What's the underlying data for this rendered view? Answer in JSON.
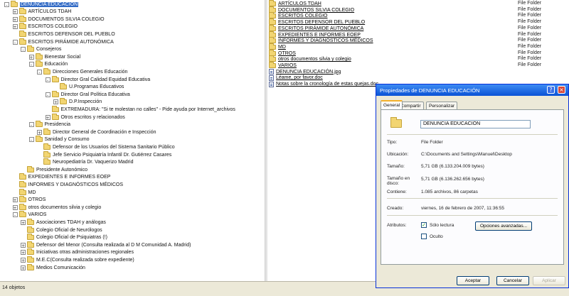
{
  "tree": [
    {
      "label": "DENUNCIA EDUCACIÓN",
      "level": 0,
      "exp": "-",
      "selected": true
    },
    {
      "label": "ARTÍCULOS TDAH",
      "level": 1,
      "exp": "+"
    },
    {
      "label": "DOCUMENTOS SILVIA COLEGIO",
      "level": 1,
      "exp": "+"
    },
    {
      "label": "ESCRITOS COLEGIO",
      "level": 1,
      "exp": "+"
    },
    {
      "label": "ESCRITOS DEFENSOR DEL PUEBLO",
      "level": 1,
      "exp": ""
    },
    {
      "label": "ESCRITOS PIRÁMIDE AUTONÓMICA",
      "level": 1,
      "exp": "-"
    },
    {
      "label": "Consejeros",
      "level": 2,
      "exp": "-"
    },
    {
      "label": "Bienestar Social",
      "level": 3,
      "exp": "+"
    },
    {
      "label": "Educación",
      "level": 3,
      "exp": "-"
    },
    {
      "label": "Direcciones Generales Educación",
      "level": 4,
      "exp": "-"
    },
    {
      "label": "Director Gral Calidad Equidad Educativa",
      "level": 5,
      "exp": "-"
    },
    {
      "label": "U.Programas Educativos",
      "level": 6,
      "exp": ""
    },
    {
      "label": "Director Gral Política Educativa",
      "level": 5,
      "exp": "-"
    },
    {
      "label": "D.P.Inspección",
      "level": 6,
      "exp": "+"
    },
    {
      "label": "EXTREMADURA: \"Si te molestan no calles\" - Pide ayuda por Internet_archivos",
      "level": 5,
      "exp": ""
    },
    {
      "label": "Otros escritos y relacionados",
      "level": 5,
      "exp": "+"
    },
    {
      "label": "Presidencia",
      "level": 3,
      "exp": "-"
    },
    {
      "label": "Director General de Coordinación e Inspección",
      "level": 4,
      "exp": "+"
    },
    {
      "label": "Sanidad y Consumo",
      "level": 3,
      "exp": "-"
    },
    {
      "label": "Defensor de los Usuarios del Sistema Sanitario Público",
      "level": 4,
      "exp": ""
    },
    {
      "label": "Jefe Servicio Psiquiatría Infantil Dr. Gutiérrez Casares",
      "level": 4,
      "exp": ""
    },
    {
      "label": "Neuropediatría Dr. Vaquerizo Madrid",
      "level": 4,
      "exp": ""
    },
    {
      "label": "Presidente Autonómico",
      "level": 2,
      "exp": ""
    },
    {
      "label": "EXPEDIENTES E INFORMES EOEP",
      "level": 1,
      "exp": ""
    },
    {
      "label": "INFORMES Y DIAGNÓSTICOS MÉDICOS",
      "level": 1,
      "exp": ""
    },
    {
      "label": "MD",
      "level": 1,
      "exp": ""
    },
    {
      "label": "OTROS",
      "level": 1,
      "exp": "+"
    },
    {
      "label": "otros documentos silvia y colegio",
      "level": 1,
      "exp": "+"
    },
    {
      "label": "VARIOS",
      "level": 1,
      "exp": "-"
    },
    {
      "label": "Asociaciones TDAH y análogas",
      "level": 2,
      "exp": "+"
    },
    {
      "label": "Colegio Oficial de Neurólogos",
      "level": 2,
      "exp": ""
    },
    {
      "label": "Colegio Oficial de Psiquiatras (!)",
      "level": 2,
      "exp": ""
    },
    {
      "label": "Defensor del Menor (Consulta realizada al D M Comunidad A. Madrid)",
      "level": 2,
      "exp": "+"
    },
    {
      "label": "Iniciativas otras administraciones regionales",
      "level": 2,
      "exp": "+"
    },
    {
      "label": "M.E.C(Consulta realizada sobre expediente)",
      "level": 2,
      "exp": "+"
    },
    {
      "label": "Medios Comunicación",
      "level": 2,
      "exp": "+"
    }
  ],
  "files": [
    {
      "name": "ARTÍCULOS TDAH",
      "type": "File Folder",
      "kind": "folder"
    },
    {
      "name": "DOCUMENTOS SILVIA COLEGIO",
      "type": "File Folder",
      "kind": "folder"
    },
    {
      "name": "ESCRITOS COLEGIO",
      "type": "File Folder",
      "kind": "folder"
    },
    {
      "name": "ESCRITOS DEFENSOR DEL PUEBLO",
      "type": "File Folder",
      "kind": "folder"
    },
    {
      "name": "ESCRITOS PIRÁMIDE AUTONÓMICA",
      "type": "File Folder",
      "kind": "folder"
    },
    {
      "name": "EXPEDIENTES E INFORMES EOEP",
      "type": "File Folder",
      "kind": "folder"
    },
    {
      "name": "INFORMES Y DIAGNÓSTICOS MÉDICOS",
      "type": "File Folder",
      "kind": "folder"
    },
    {
      "name": "MD",
      "type": "File Folder",
      "kind": "folder"
    },
    {
      "name": "OTROS",
      "type": "File Folder",
      "kind": "folder"
    },
    {
      "name": "otros documentos silvia y colegio",
      "type": "File Folder",
      "kind": "folder"
    },
    {
      "name": "VARIOS",
      "type": "File Folder",
      "kind": "folder"
    },
    {
      "name": "DENUNCIA EDUCACIÓN.jpg",
      "type": "",
      "kind": "doc"
    },
    {
      "name": "Léame, por favor.doc",
      "type": "",
      "kind": "doc"
    },
    {
      "name": "Notas sobre la cronología de estas quejas.doc",
      "type": "",
      "kind": "doc"
    }
  ],
  "status": {
    "text": "14 objetos"
  },
  "dialog": {
    "title": "Propiedades de DENUNCIA EDUCACIÓN",
    "help_symbol": "?",
    "close_symbol": "×",
    "tabs": [
      "General",
      "Compartir",
      "Personalizar"
    ],
    "name_value": "DENUNCIA EDUCACIÓN",
    "props": {
      "tipo_label": "Tipo:",
      "tipo_value": "File Folder",
      "ubicacion_label": "Ubicación:",
      "ubicacion_value": "C:\\Documents and Settings\\Manuel\\Desktop",
      "tamano_label": "Tamaño:",
      "tamano_value": "5,71 GB (6.133.204.009 bytes)",
      "tamano_disco_label": "Tamaño en disco:",
      "tamano_disco_value": "5,71 GB (6.136.262.656 bytes)",
      "contiene_label": "Contiene:",
      "contiene_value": "1.085 archivos, 86 carpetas",
      "creado_label": "Creado:",
      "creado_value": "viernes, 16 de febrero de 2007, 11:36:55",
      "atributos_label": "Atributos:",
      "solo_lectura_label": "Sólo lectura",
      "oculto_label": "Oculto",
      "check_mark": "✓",
      "avanzadas_label": "Opciones avanzadas..."
    },
    "buttons": {
      "aceptar": "Aceptar",
      "cancelar": "Cancelar",
      "aplicar": "Aplicar"
    }
  }
}
